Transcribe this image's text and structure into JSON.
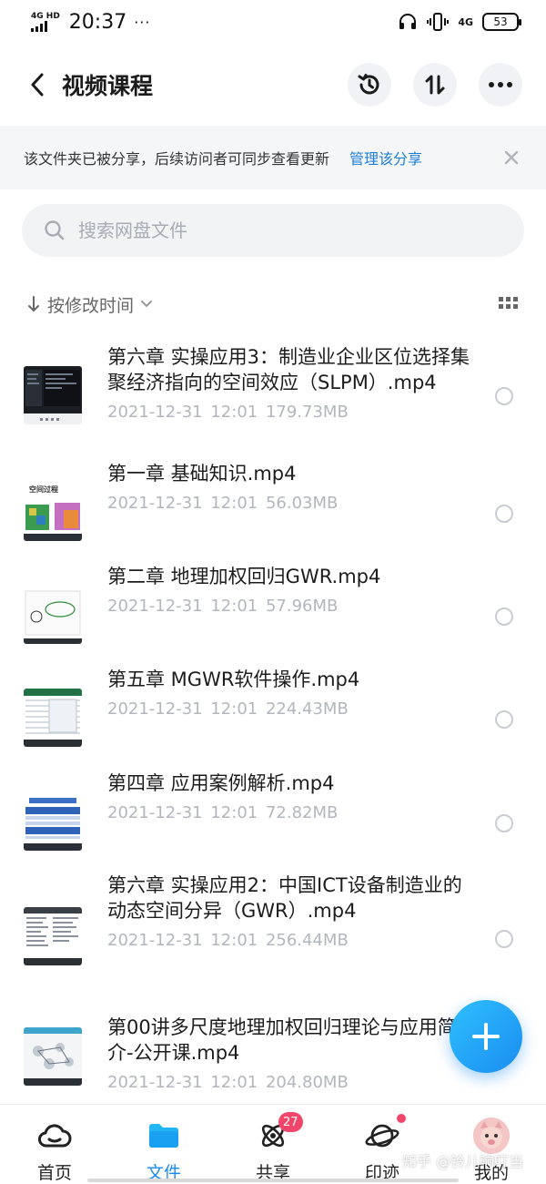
{
  "status_bar": {
    "network": "4G HD",
    "time": "20:37",
    "more_dots": "···",
    "signal_right": "4G",
    "battery": "53"
  },
  "header": {
    "title": "视频课程"
  },
  "banner": {
    "text": "该文件夹已被分享，后续访问者可同步查看更新",
    "link": "管理该分享"
  },
  "search": {
    "placeholder": "搜索网盘文件"
  },
  "sort": {
    "label": "按修改时间"
  },
  "files": [
    {
      "name": "第六章 实操应用3：制造业企业区位选择集聚经济指向的空间效应（SLPM）.mp4",
      "date": "2021-12-31",
      "time": "12:01",
      "size": "179.73MB"
    },
    {
      "name": "第一章 基础知识.mp4",
      "date": "2021-12-31",
      "time": "12:01",
      "size": "56.03MB"
    },
    {
      "name": "第二章 地理加权回归GWR.mp4",
      "date": "2021-12-31",
      "time": "12:01",
      "size": "57.96MB"
    },
    {
      "name": "第五章 MGWR软件操作.mp4",
      "date": "2021-12-31",
      "time": "12:01",
      "size": "224.43MB"
    },
    {
      "name": "第四章 应用案例解析.mp4",
      "date": "2021-12-31",
      "time": "12:01",
      "size": "72.82MB"
    },
    {
      "name": "第六章 实操应用2：中国ICT设备制造业的动态空间分异（GWR）.mp4",
      "date": "2021-12-31",
      "time": "12:01",
      "size": "256.44MB"
    },
    {
      "name": "第00讲多尺度地理加权回归理论与应用简介-公开课.mp4",
      "date": "2021-12-31",
      "time": "12:01",
      "size": "204.80MB"
    }
  ],
  "thumb_labels": {
    "chapter1": "空间过程"
  },
  "bottom_nav": {
    "items": [
      {
        "label": "首页",
        "icon": "cloud-home-icon"
      },
      {
        "label": "文件",
        "icon": "folder-icon"
      },
      {
        "label": "共享",
        "icon": "atom-share-icon",
        "badge": "27"
      },
      {
        "label": "印迹",
        "icon": "planet-icon"
      },
      {
        "label": "我的",
        "icon": "avatar"
      }
    ]
  },
  "watermark": "知乎 @铃儿响叮当",
  "colors": {
    "accent": "#1a8cf0",
    "badge": "#f0466a",
    "link": "#1e7fd6"
  }
}
